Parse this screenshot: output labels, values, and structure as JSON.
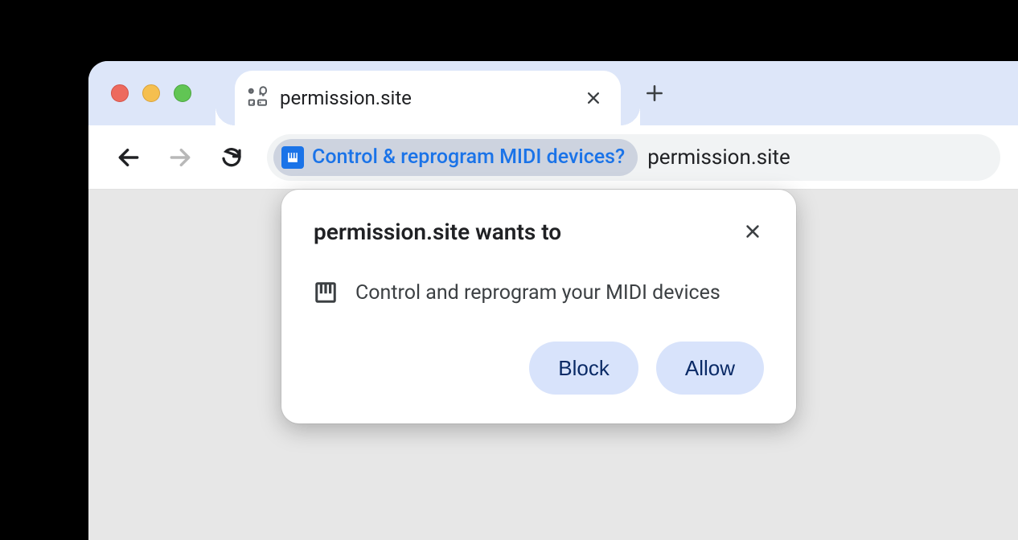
{
  "tab": {
    "title": "permission.site"
  },
  "omnibox": {
    "chip_label": "Control & reprogram MIDI devices?",
    "url": "permission.site"
  },
  "bubble": {
    "title": "permission.site wants to",
    "permission_text": "Control and reprogram your MIDI devices",
    "block_label": "Block",
    "allow_label": "Allow"
  }
}
